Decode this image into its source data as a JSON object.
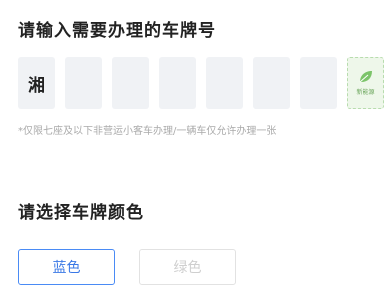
{
  "plate_section": {
    "title": "请输入需要办理的车牌号",
    "province": "湘",
    "new_energy_label": "新能源",
    "note": "*仅限七座及以下非营运小客车办理/一辆车仅允许办理一张"
  },
  "color_section": {
    "title": "请选择车牌颜色",
    "options": [
      {
        "label": "蓝色",
        "selected": true
      },
      {
        "label": "绿色",
        "selected": false
      }
    ]
  },
  "colors": {
    "accent_blue": "#4a8bf5",
    "plate_box_bg": "#f0f2f5",
    "new_energy_green": "#6aa55a"
  },
  "icons": {
    "new_energy": "leaf-icon"
  }
}
